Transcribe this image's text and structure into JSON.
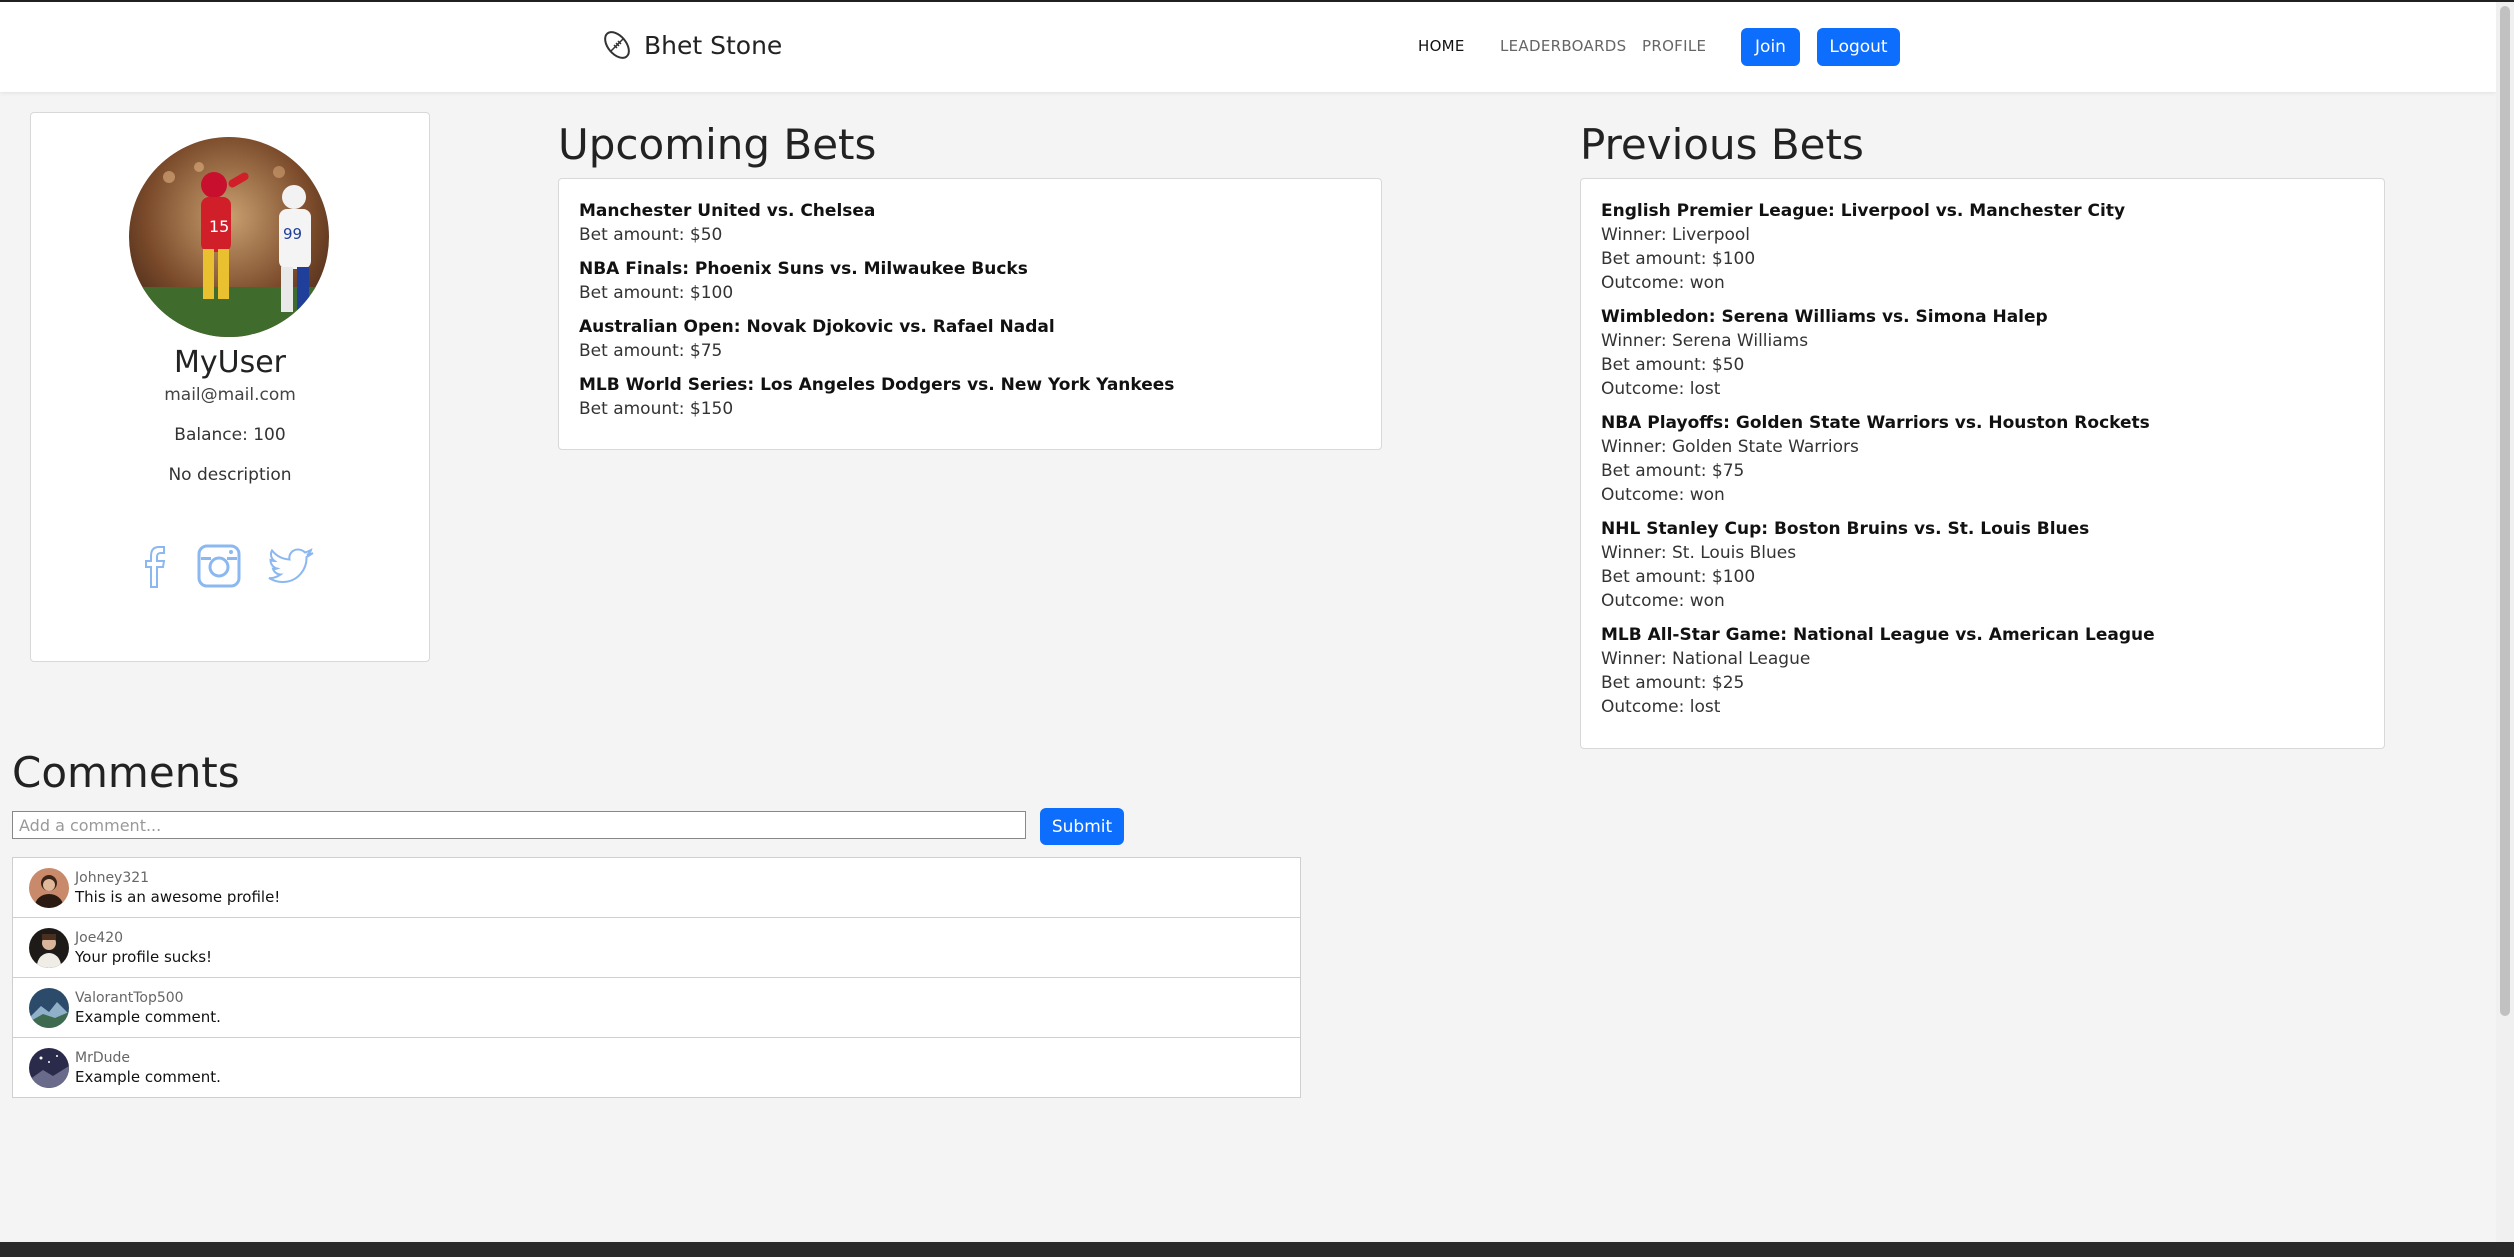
{
  "nav": {
    "brand": "Bhet Stone",
    "links": [
      "HOME",
      "LEADERBOARDS",
      "PROFILE"
    ],
    "join_label": "Join",
    "logout_label": "Logout"
  },
  "profile": {
    "name": "MyUser",
    "email": "mail@mail.com",
    "balance": "Balance: 100",
    "description": "No description",
    "socials": [
      "facebook-icon",
      "instagram-icon",
      "twitter-icon"
    ]
  },
  "upcoming": {
    "title": "Upcoming Bets",
    "bets": [
      {
        "match": "Manchester United vs. Chelsea",
        "amount": "Bet amount: $50"
      },
      {
        "match": "NBA Finals: Phoenix Suns vs. Milwaukee Bucks",
        "amount": "Bet amount: $100"
      },
      {
        "match": "Australian Open: Novak Djokovic vs. Rafael Nadal",
        "amount": "Bet amount: $75"
      },
      {
        "match": "MLB World Series: Los Angeles Dodgers vs. New York Yankees",
        "amount": "Bet amount: $150"
      }
    ]
  },
  "previous": {
    "title": "Previous Bets",
    "bets": [
      {
        "match": "English Premier League: Liverpool vs. Manchester City",
        "winner": "Winner: Liverpool",
        "amount": "Bet amount: $100",
        "outcome": "Outcome: won"
      },
      {
        "match": "Wimbledon: Serena Williams vs. Simona Halep",
        "winner": "Winner: Serena Williams",
        "amount": "Bet amount: $50",
        "outcome": "Outcome: lost"
      },
      {
        "match": "NBA Playoffs: Golden State Warriors vs. Houston Rockets",
        "winner": "Winner: Golden State Warriors",
        "amount": "Bet amount: $75",
        "outcome": "Outcome: won"
      },
      {
        "match": "NHL Stanley Cup: Boston Bruins vs. St. Louis Blues",
        "winner": "Winner: St. Louis Blues",
        "amount": "Bet amount: $100",
        "outcome": "Outcome: won"
      },
      {
        "match": "MLB All-Star Game: National League vs. American League",
        "winner": "Winner: National League",
        "amount": "Bet amount: $25",
        "outcome": "Outcome: lost"
      }
    ]
  },
  "comments": {
    "title": "Comments",
    "placeholder": "Add a comment...",
    "submit_label": "Submit",
    "items": [
      {
        "user": "Johney321",
        "text": "This is an awesome profile!"
      },
      {
        "user": "Joe420",
        "text": "Your profile sucks!"
      },
      {
        "user": "ValorantTop500",
        "text": "Example comment."
      },
      {
        "user": "MrDude",
        "text": "Example comment."
      }
    ]
  },
  "colors": {
    "accent": "#0d6efd",
    "background": "#f4f4f4"
  }
}
